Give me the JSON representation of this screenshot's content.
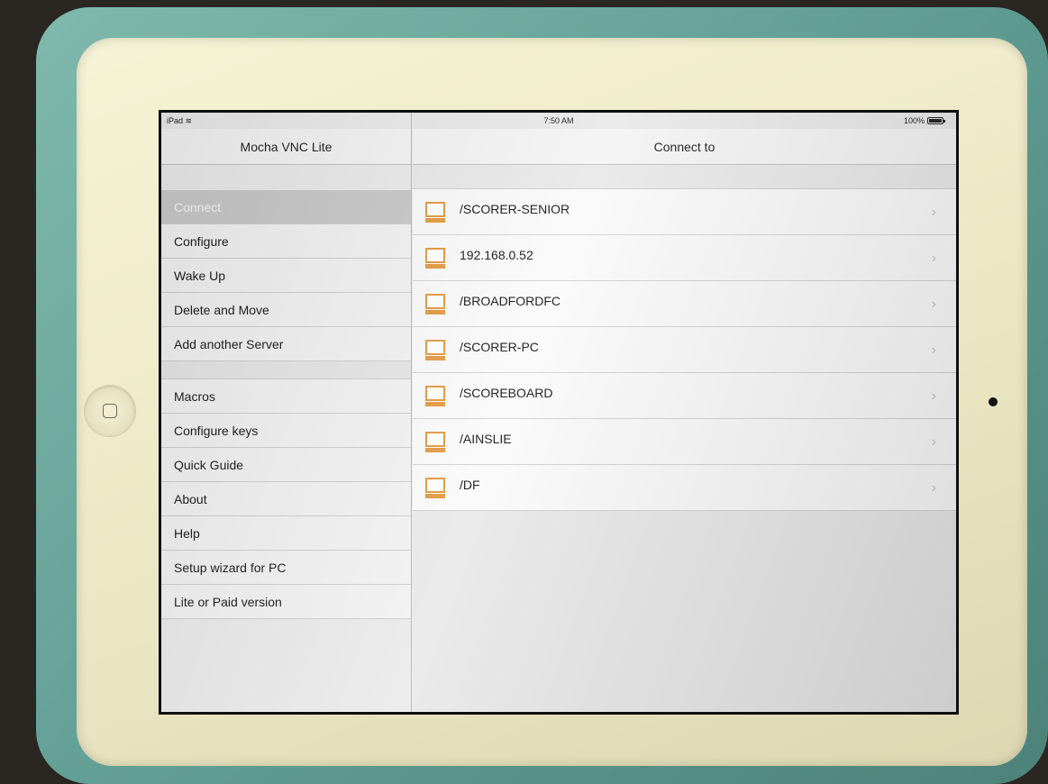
{
  "status_bar": {
    "device": "iPad",
    "time": "7:50 AM",
    "battery": "100%"
  },
  "master": {
    "title": "Mocha VNC Lite",
    "groups": [
      [
        {
          "label": "Connect",
          "selected": true
        },
        {
          "label": "Configure"
        },
        {
          "label": "Wake Up"
        },
        {
          "label": "Delete and Move"
        },
        {
          "label": "Add another Server"
        }
      ],
      [
        {
          "label": "Macros"
        },
        {
          "label": "Configure keys"
        },
        {
          "label": "Quick Guide"
        },
        {
          "label": "About"
        },
        {
          "label": "Help"
        },
        {
          "label": "Setup wizard for PC"
        },
        {
          "label": "Lite or Paid version"
        }
      ]
    ]
  },
  "detail": {
    "title": "Connect to",
    "servers": [
      {
        "name": "/SCORER-SENIOR"
      },
      {
        "name": "192.168.0.52"
      },
      {
        "name": "/BROADFORDFC"
      },
      {
        "name": "/SCORER-PC"
      },
      {
        "name": "/SCOREBOARD"
      },
      {
        "name": "/AINSLIE"
      },
      {
        "name": "/DF"
      }
    ],
    "row_icon": "computer-icon",
    "accessory_icon": "chevron-right-icon",
    "icon_color": "#e49a43"
  }
}
